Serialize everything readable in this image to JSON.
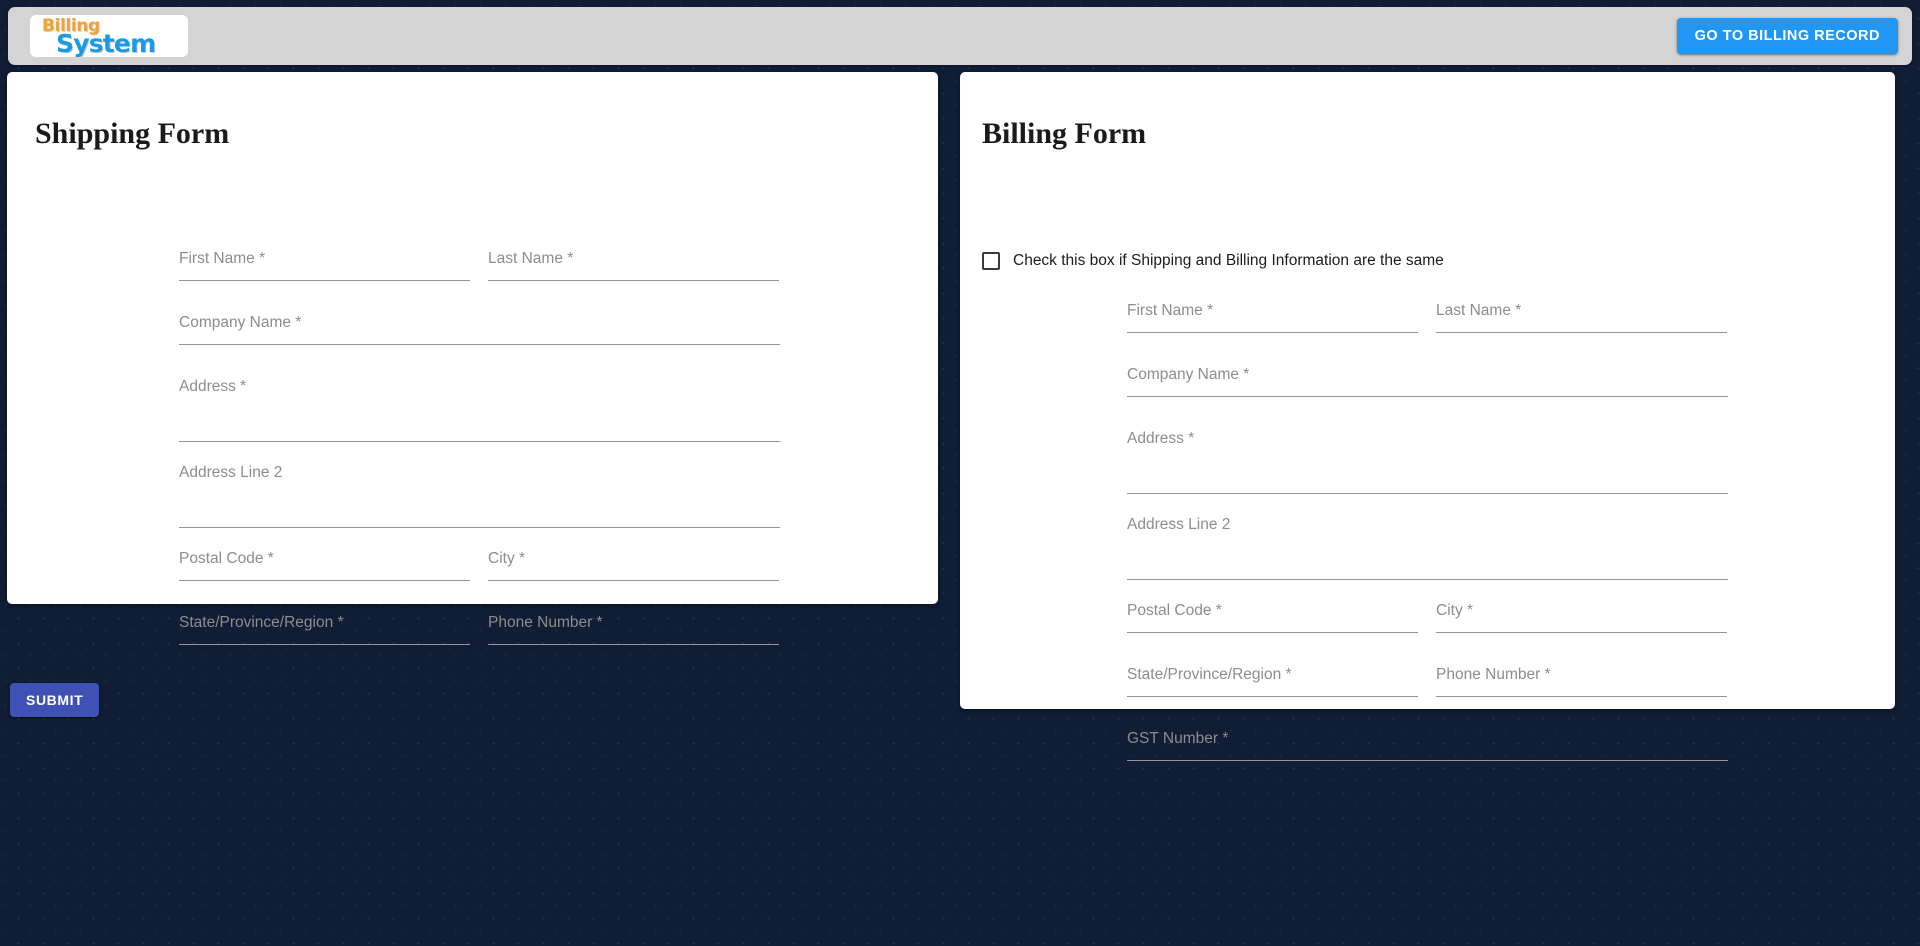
{
  "header": {
    "logo": {
      "line1": "Billing",
      "line2": "System",
      "color_line1": "#f2a138",
      "color_line2": "#1b9ae4"
    },
    "billing_record_button": "GO TO BILLING RECORD",
    "billing_record_button_color": "#2196f3",
    "bar_color": "#d4d4d4"
  },
  "page": {
    "background_color": "#101d35",
    "card_color": "#ffffff"
  },
  "shipping_form": {
    "title": "Shipping Form",
    "fields": [
      {
        "label": "First Name *",
        "value": "",
        "placeholder": "First Name *",
        "size": "half",
        "type": "single"
      },
      {
        "label": "Last Name *",
        "value": "",
        "placeholder": "Last Name *",
        "size": "half",
        "type": "single"
      },
      {
        "label": "Company Name *",
        "value": "",
        "placeholder": "Company Name *",
        "size": "full",
        "type": "single"
      },
      {
        "label": "Address *",
        "value": "",
        "placeholder": "Address *",
        "size": "full",
        "type": "tall"
      },
      {
        "label": "Address Line 2",
        "value": "",
        "placeholder": "Address Line 2",
        "size": "full",
        "type": "tall"
      },
      {
        "label": "Postal Code *",
        "value": "",
        "placeholder": "Postal Code *",
        "size": "half",
        "type": "single"
      },
      {
        "label": "City *",
        "value": "",
        "placeholder": "City *",
        "size": "half",
        "type": "single"
      },
      {
        "label": "State/Province/Region *",
        "value": "",
        "placeholder": "State/Province/Region *",
        "size": "half",
        "type": "single"
      },
      {
        "label": "Phone Number *",
        "value": "",
        "placeholder": "Phone Number *",
        "size": "half",
        "type": "single"
      }
    ]
  },
  "billing_form": {
    "title": "Billing Form",
    "same_as_shipping_label": "Check this box if Shipping and Billing Information are the same",
    "same_as_shipping_checked": false,
    "fields": [
      {
        "label": "First Name *",
        "value": "",
        "placeholder": "First Name *",
        "size": "half",
        "type": "single"
      },
      {
        "label": "Last Name *",
        "value": "",
        "placeholder": "Last Name *",
        "size": "half",
        "type": "single"
      },
      {
        "label": "Company Name *",
        "value": "",
        "placeholder": "Company Name *",
        "size": "full",
        "type": "single"
      },
      {
        "label": "Address *",
        "value": "",
        "placeholder": "Address *",
        "size": "full",
        "type": "tall"
      },
      {
        "label": "Address Line 2",
        "value": "",
        "placeholder": "Address Line 2",
        "size": "full",
        "type": "tall"
      },
      {
        "label": "Postal Code *",
        "value": "",
        "placeholder": "Postal Code *",
        "size": "half",
        "type": "single"
      },
      {
        "label": "City *",
        "value": "",
        "placeholder": "City *",
        "size": "half",
        "type": "single"
      },
      {
        "label": "State/Province/Region *",
        "value": "",
        "placeholder": "State/Province/Region *",
        "size": "half",
        "type": "single"
      },
      {
        "label": "Phone Number *",
        "value": "",
        "placeholder": "Phone Number *",
        "size": "half",
        "type": "single"
      },
      {
        "label": "GST Number *",
        "value": "",
        "placeholder": "GST Number *",
        "size": "full",
        "type": "single"
      }
    ]
  },
  "submit_button": {
    "label": "SUBMIT",
    "color": "#3f51b5"
  }
}
